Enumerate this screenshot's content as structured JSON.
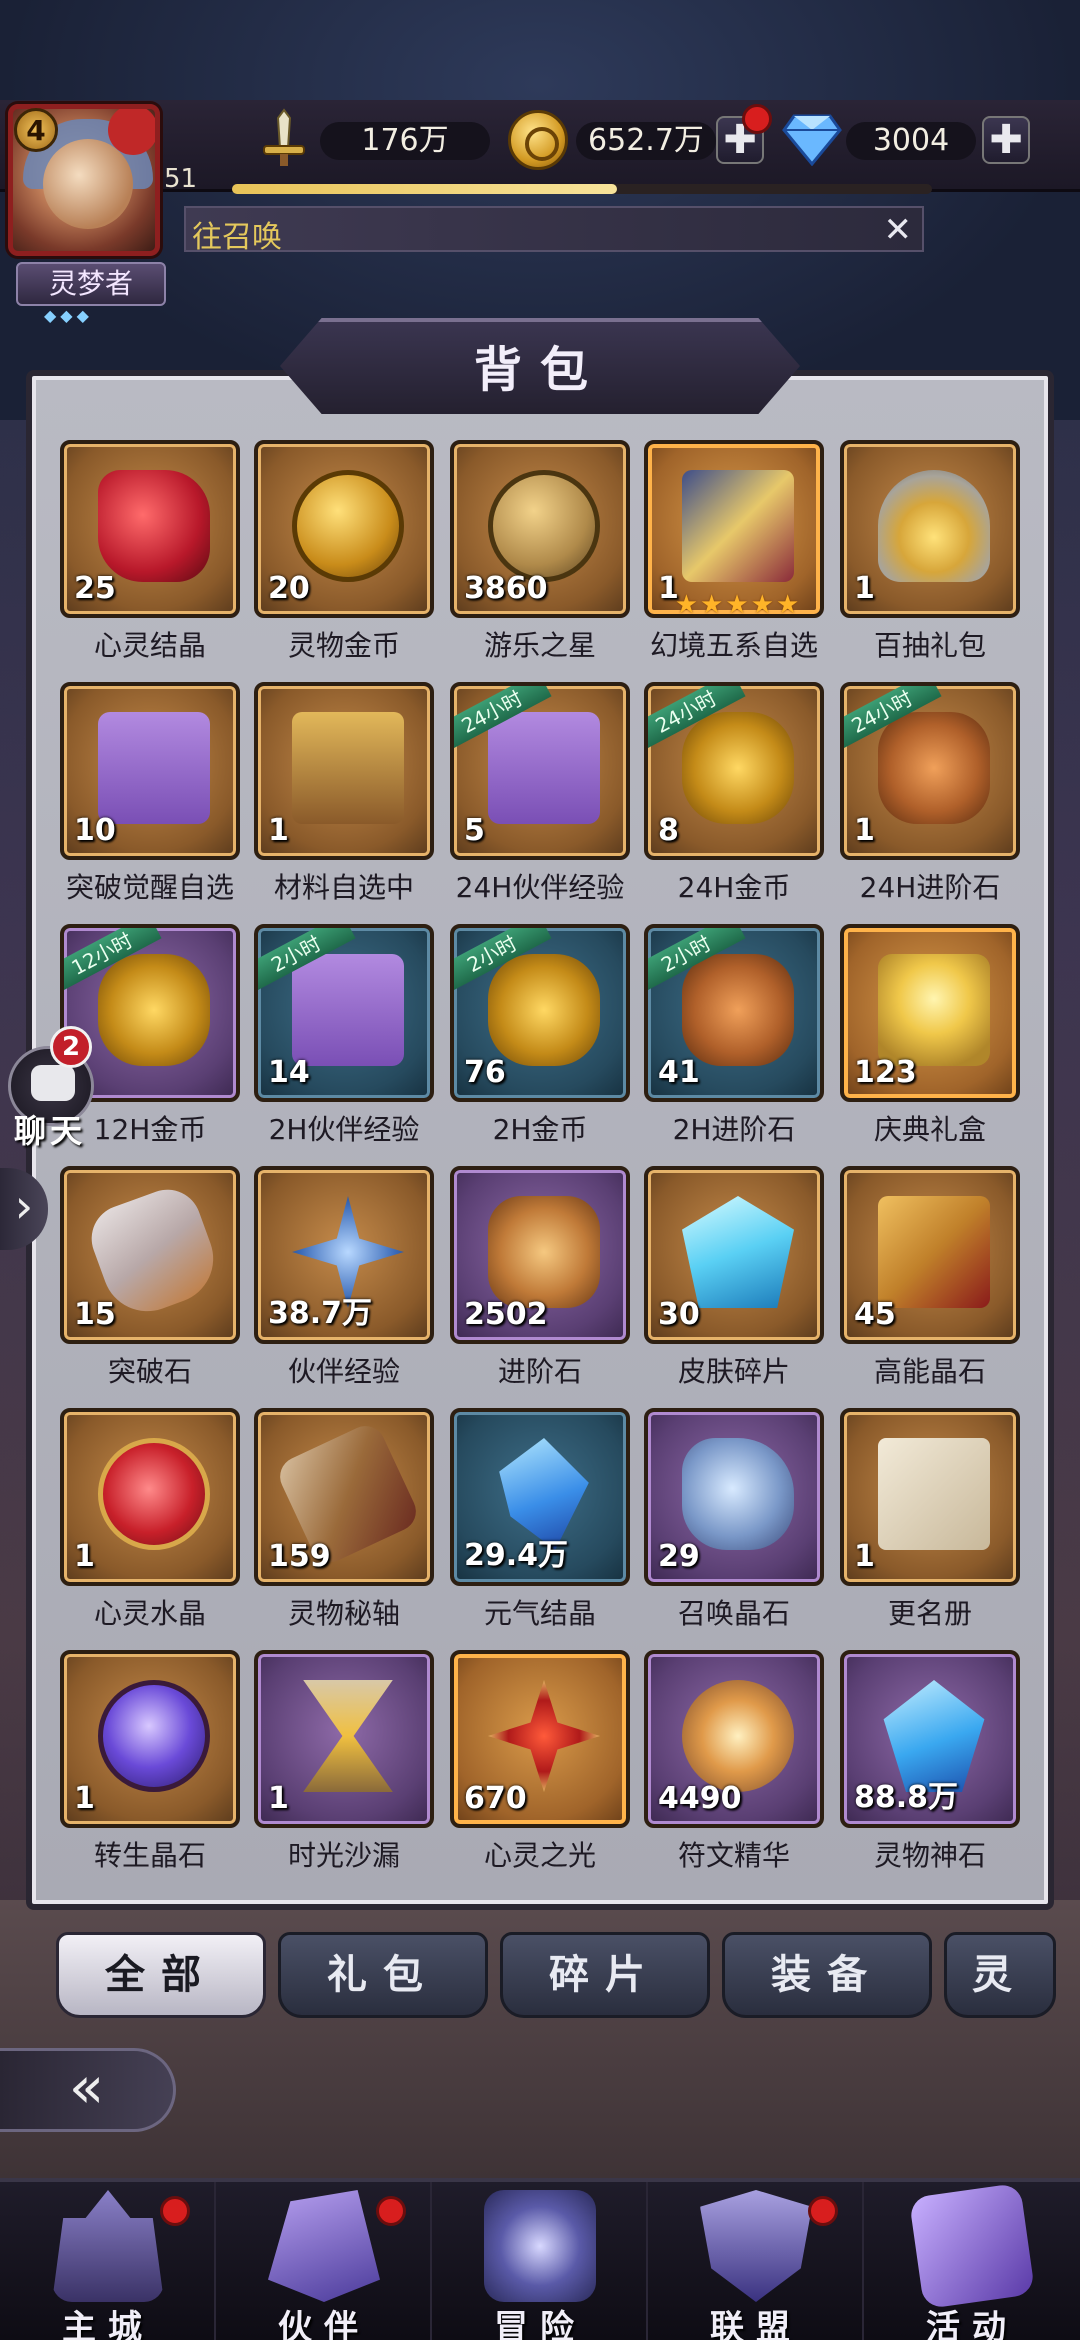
{
  "header": {
    "avatar_level": "4",
    "player_level": "51",
    "exp_fraction": 0.55,
    "power_value": "176万",
    "gold_value": "652.7万",
    "diamond_value": "3004",
    "plus_symbol": "✚",
    "notice_text": "往召唤",
    "notice_close": "✕",
    "title_plate": "灵梦者",
    "title_stars": "◆◆◆"
  },
  "panel": {
    "title": "背包"
  },
  "items": [
    {
      "name": "心灵结晶",
      "count": "25",
      "frame": "gold",
      "art": "a-red"
    },
    {
      "name": "灵物金币",
      "count": "20",
      "frame": "gold",
      "art": "a-goldcoin"
    },
    {
      "name": "游乐之星",
      "count": "3860",
      "frame": "gold",
      "art": "a-bronzecoin"
    },
    {
      "name": "幻境五系自选",
      "count": "1",
      "frame": "orange",
      "art": "a-cards",
      "stars": "★★★★★"
    },
    {
      "name": "百抽礼包",
      "count": "1",
      "frame": "gold",
      "art": "a-shell"
    },
    {
      "name": "突破觉醒自选",
      "count": "10",
      "frame": "gold",
      "art": "a-giftp"
    },
    {
      "name": "材料自选中",
      "count": "1",
      "frame": "gold",
      "art": "a-crate"
    },
    {
      "name": "24H伙伴经验",
      "count": "5",
      "frame": "gold",
      "art": "a-giftp",
      "ribbon": "24小时"
    },
    {
      "name": "24H金币",
      "count": "8",
      "frame": "gold",
      "art": "a-coins",
      "ribbon": "24小时"
    },
    {
      "name": "24H进阶石",
      "count": "1",
      "frame": "gold",
      "art": "a-rocks",
      "ribbon": "24小时"
    },
    {
      "name": "12H金币",
      "count": "",
      "frame": "purple",
      "art": "a-coins",
      "ribbon": "12小时"
    },
    {
      "name": "2H伙伴经验",
      "count": "14",
      "frame": "blue",
      "art": "a-giftp",
      "ribbon": "2小时"
    },
    {
      "name": "2H金币",
      "count": "76",
      "frame": "blue",
      "art": "a-coins",
      "ribbon": "2小时"
    },
    {
      "name": "2H进阶石",
      "count": "41",
      "frame": "blue",
      "art": "a-rocks",
      "ribbon": "2小时"
    },
    {
      "name": "庆典礼盒",
      "count": "123",
      "frame": "orange",
      "art": "a-boxglow"
    },
    {
      "name": "突破石",
      "count": "15",
      "frame": "gold",
      "art": "a-crystal"
    },
    {
      "name": "伙伴经验",
      "count": "38.7万",
      "frame": "gold",
      "art": "a-exp"
    },
    {
      "name": "进阶石",
      "count": "2502",
      "frame": "purple",
      "art": "a-spiral"
    },
    {
      "name": "皮肤碎片",
      "count": "30",
      "frame": "gold",
      "art": "a-cyan"
    },
    {
      "name": "高能晶石",
      "count": "45",
      "frame": "gold",
      "art": "a-book"
    },
    {
      "name": "心灵水晶",
      "count": "1",
      "frame": "gold",
      "art": "a-heart"
    },
    {
      "name": "灵物秘轴",
      "count": "159",
      "frame": "gold",
      "art": "a-scroll"
    },
    {
      "name": "元气结晶",
      "count": "29.4万",
      "frame": "blue",
      "art": "a-bluecry"
    },
    {
      "name": "召唤晶石",
      "count": "29",
      "frame": "purple",
      "art": "a-summon"
    },
    {
      "name": "更名册",
      "count": "1",
      "frame": "gold",
      "art": "a-paper"
    },
    {
      "name": "转生晶石",
      "count": "1",
      "frame": "gold",
      "art": "a-orb"
    },
    {
      "name": "时光沙漏",
      "count": "1",
      "frame": "purple",
      "art": "a-hourglass"
    },
    {
      "name": "心灵之光",
      "count": "670",
      "frame": "orange",
      "art": "a-redstar"
    },
    {
      "name": "符文精华",
      "count": "4490",
      "frame": "purple",
      "art": "a-rune"
    },
    {
      "name": "灵物神石",
      "count": "88.8万",
      "frame": "purple",
      "art": "a-bluegem"
    }
  ],
  "side": {
    "chat_badge": "2",
    "chat_label": "聊天",
    "expand_arrow": "›"
  },
  "tabs": [
    {
      "label": "全部",
      "active": true
    },
    {
      "label": "礼包",
      "active": false
    },
    {
      "label": "碎片",
      "active": false
    },
    {
      "label": "装备",
      "active": false
    },
    {
      "label": "灵",
      "active": false
    }
  ],
  "back_symbol": "«",
  "bottom_nav": [
    {
      "label": "主城",
      "icon": "castle-icon",
      "badge": true
    },
    {
      "label": "伙伴",
      "icon": "wizard-hat-icon",
      "badge": true
    },
    {
      "label": "冒险",
      "icon": "compass-icon",
      "badge": false
    },
    {
      "label": "联盟",
      "icon": "shield-icon",
      "badge": true
    },
    {
      "label": "活动",
      "icon": "cards-icon",
      "badge": false
    }
  ],
  "colors": {
    "panel_bg": "#b0b1bb",
    "gold_text": "#e4c85c",
    "badge_red": "#d81e1e"
  }
}
